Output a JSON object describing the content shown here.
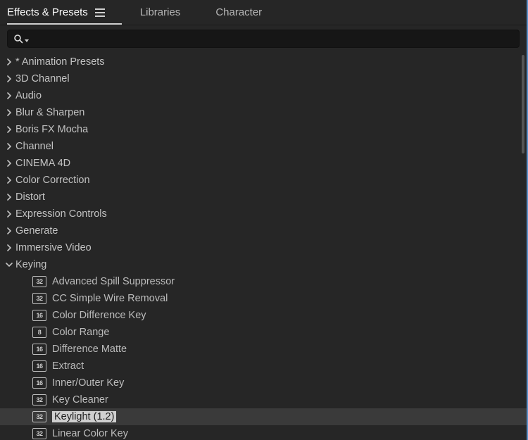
{
  "tabs": [
    {
      "label": "Effects & Presets",
      "active": true
    },
    {
      "label": "Libraries",
      "active": false
    },
    {
      "label": "Character",
      "active": false
    }
  ],
  "search": {
    "value": "",
    "placeholder": ""
  },
  "categories": [
    {
      "label": "* Animation Presets",
      "expanded": false
    },
    {
      "label": "3D Channel",
      "expanded": false
    },
    {
      "label": "Audio",
      "expanded": false
    },
    {
      "label": "Blur & Sharpen",
      "expanded": false
    },
    {
      "label": "Boris FX Mocha",
      "expanded": false
    },
    {
      "label": "Channel",
      "expanded": false
    },
    {
      "label": "CINEMA 4D",
      "expanded": false
    },
    {
      "label": "Color Correction",
      "expanded": false
    },
    {
      "label": "Distort",
      "expanded": false
    },
    {
      "label": "Expression Controls",
      "expanded": false
    },
    {
      "label": "Generate",
      "expanded": false
    },
    {
      "label": "Immersive Video",
      "expanded": false
    },
    {
      "label": "Keying",
      "expanded": true,
      "children": [
        {
          "label": "Advanced Spill Suppressor",
          "bits": "32",
          "selected": false
        },
        {
          "label": "CC Simple Wire Removal",
          "bits": "32",
          "selected": false
        },
        {
          "label": "Color Difference Key",
          "bits": "16",
          "selected": false
        },
        {
          "label": "Color Range",
          "bits": "8",
          "selected": false
        },
        {
          "label": "Difference Matte",
          "bits": "16",
          "selected": false
        },
        {
          "label": "Extract",
          "bits": "16",
          "selected": false
        },
        {
          "label": "Inner/Outer Key",
          "bits": "16",
          "selected": false
        },
        {
          "label": "Key Cleaner",
          "bits": "32",
          "selected": false
        },
        {
          "label": "Keylight (1.2)",
          "bits": "32",
          "selected": true
        },
        {
          "label": "Linear Color Key",
          "bits": "32",
          "selected": false
        }
      ]
    }
  ]
}
